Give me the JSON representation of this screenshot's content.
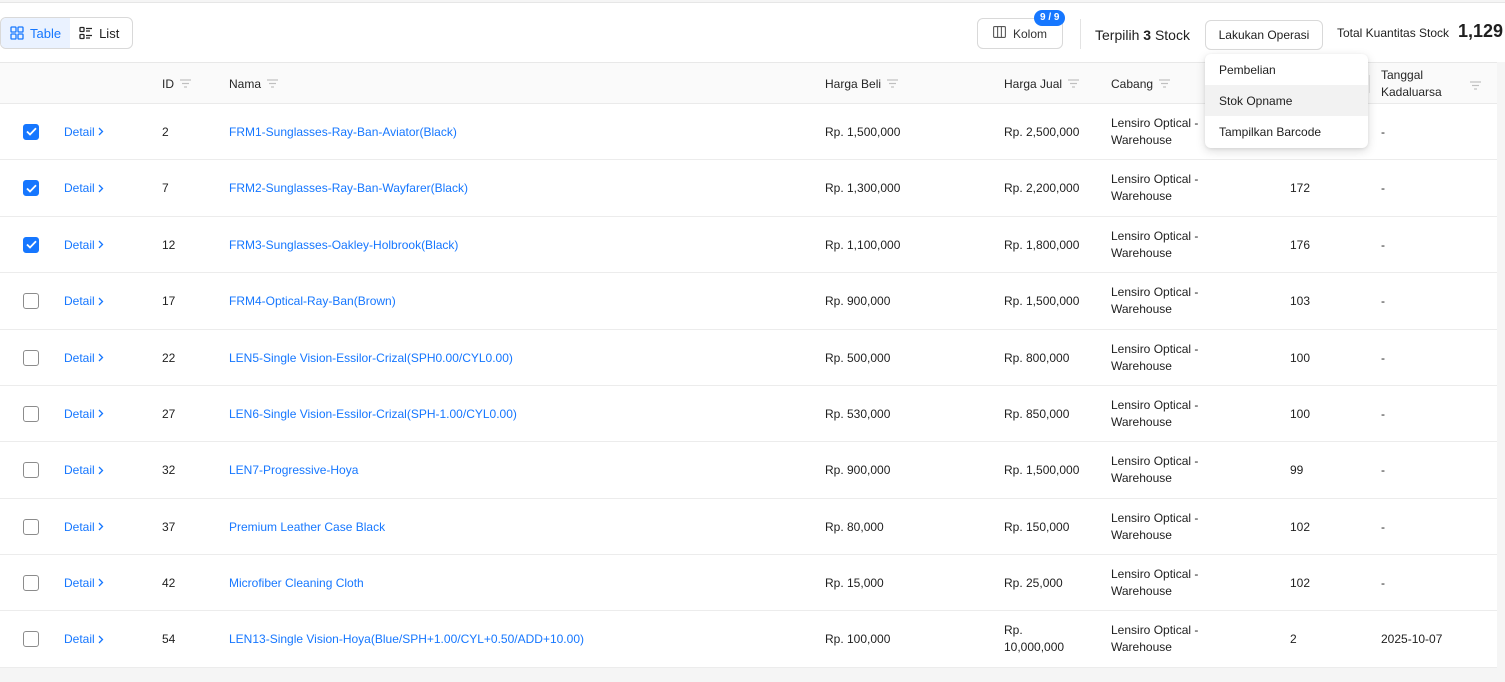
{
  "toolbar": {
    "view_table_label": "Table",
    "view_list_label": "List",
    "kolom_label": "Kolom",
    "kolom_badge": "9 / 9",
    "terpilih_prefix": "Terpilih",
    "terpilih_count": "3",
    "terpilih_suffix": "Stock",
    "operasi_label": "Lakukan Operasi",
    "total_label": "Total Kuantitas Stock",
    "total_value": "1,129"
  },
  "dropdown": {
    "items": [
      "Pembelian",
      "Stok Opname",
      "Tampilkan Barcode"
    ],
    "hovered": "Stok Opname"
  },
  "columns": {
    "id": "ID",
    "nama": "Nama",
    "harga_beli": "Harga Beli",
    "harga_jual": "Harga Jual",
    "cabang": "Cabang",
    "tanggal_1": "Tanggal",
    "tanggal_2": "Kadaluarsa"
  },
  "rows": [
    {
      "checked": true,
      "detail": "Detail",
      "id": "2",
      "nama": "FRM1-Sunglasses-Ray-Ban-Aviator(Black)",
      "harga_beli": "Rp. 1,500,000",
      "harga_jual": "Rp. 2,500,000",
      "cabang_1": "Lensiro Optical -",
      "cabang_2": "Warehouse",
      "qty": "",
      "tanggal": "-"
    },
    {
      "checked": true,
      "detail": "Detail",
      "id": "7",
      "nama": "FRM2-Sunglasses-Ray-Ban-Wayfarer(Black)",
      "harga_beli": "Rp. 1,300,000",
      "harga_jual": "Rp. 2,200,000",
      "cabang_1": "Lensiro Optical -",
      "cabang_2": "Warehouse",
      "qty": "172",
      "tanggal": "-"
    },
    {
      "checked": true,
      "detail": "Detail",
      "id": "12",
      "nama": "FRM3-Sunglasses-Oakley-Holbrook(Black)",
      "harga_beli": "Rp. 1,100,000",
      "harga_jual": "Rp. 1,800,000",
      "cabang_1": "Lensiro Optical -",
      "cabang_2": "Warehouse",
      "qty": "176",
      "tanggal": "-"
    },
    {
      "checked": false,
      "detail": "Detail",
      "id": "17",
      "nama": "FRM4-Optical-Ray-Ban(Brown)",
      "harga_beli": "Rp. 900,000",
      "harga_jual": "Rp. 1,500,000",
      "cabang_1": "Lensiro Optical -",
      "cabang_2": "Warehouse",
      "qty": "103",
      "tanggal": "-"
    },
    {
      "checked": false,
      "detail": "Detail",
      "id": "22",
      "nama": "LEN5-Single Vision-Essilor-Crizal(SPH0.00/CYL0.00)",
      "harga_beli": "Rp. 500,000",
      "harga_jual": "Rp. 800,000",
      "cabang_1": "Lensiro Optical -",
      "cabang_2": "Warehouse",
      "qty": "100",
      "tanggal": "-"
    },
    {
      "checked": false,
      "detail": "Detail",
      "id": "27",
      "nama": "LEN6-Single Vision-Essilor-Crizal(SPH-1.00/CYL0.00)",
      "harga_beli": "Rp. 530,000",
      "harga_jual": "Rp. 850,000",
      "cabang_1": "Lensiro Optical -",
      "cabang_2": "Warehouse",
      "qty": "100",
      "tanggal": "-"
    },
    {
      "checked": false,
      "detail": "Detail",
      "id": "32",
      "nama": "LEN7-Progressive-Hoya",
      "harga_beli": "Rp. 900,000",
      "harga_jual": "Rp. 1,500,000",
      "cabang_1": "Lensiro Optical -",
      "cabang_2": "Warehouse",
      "qty": "99",
      "tanggal": "-"
    },
    {
      "checked": false,
      "detail": "Detail",
      "id": "37",
      "nama": "Premium Leather Case Black",
      "harga_beli": "Rp. 80,000",
      "harga_jual": "Rp. 150,000",
      "cabang_1": "Lensiro Optical -",
      "cabang_2": "Warehouse",
      "qty": "102",
      "tanggal": "-"
    },
    {
      "checked": false,
      "detail": "Detail",
      "id": "42",
      "nama": "Microfiber Cleaning Cloth",
      "harga_beli": "Rp. 15,000",
      "harga_jual": "Rp. 25,000",
      "cabang_1": "Lensiro Optical -",
      "cabang_2": "Warehouse",
      "qty": "102",
      "tanggal": "-"
    },
    {
      "checked": false,
      "detail": "Detail",
      "id": "54",
      "nama": "LEN13-Single Vision-Hoya(Blue/SPH+1.00/CYL+0.50/ADD+10.00)",
      "harga_beli": "Rp. 100,000",
      "harga_jual_1": "Rp.",
      "harga_jual_2": "10,000,000",
      "cabang_1": "Lensiro Optical -",
      "cabang_2": "Warehouse",
      "qty": "2",
      "tanggal": "2025-10-07"
    }
  ],
  "colors": {
    "accent": "#1677ff",
    "badge": "#1677ff"
  },
  "icons": [
    "table-grid-icon",
    "list-icon",
    "columns-icon",
    "filter-icon",
    "chevron-right-icon",
    "check-icon"
  ]
}
